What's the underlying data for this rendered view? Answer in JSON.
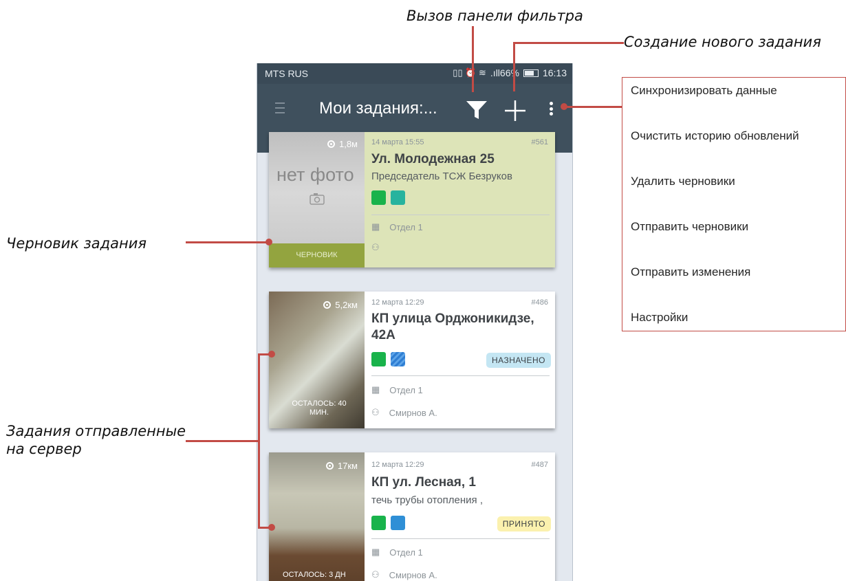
{
  "annotations": {
    "filter_call": "Вызов панели фильтра",
    "new_task": "Создание нового задания",
    "draft_task": "Черновик задания",
    "sent_line1": "Задания отправленные",
    "sent_line2": "на сервер"
  },
  "statusbar": {
    "carrier": "MTS RUS",
    "signal_battery": ".ıll66%",
    "time": "16:13"
  },
  "toolbar": {
    "title": "Мои задания:...",
    "filter_icon": "funnel-icon",
    "add_icon": "plus-icon",
    "more_icon": "more-vert-icon"
  },
  "cards": [
    {
      "date": "14 марта 15:55",
      "number": "#561",
      "title": "Ул. Молодежная 25",
      "subtitle": "Председатель ТСЖ Безруков",
      "distance": "1,8м",
      "photo_placeholder": "нет фото",
      "photo_label": "ЧЕРНОВИК",
      "department": "Отдел 1",
      "person": "",
      "status": ""
    },
    {
      "date": "12 марта 12:29",
      "number": "#486",
      "title": "КП улица Орджоникидзе, 42А",
      "subtitle": "",
      "distance": "5,2км",
      "photo_label": "ОСТАЛОСЬ: 40 МИН.",
      "department": "Отдел 1",
      "person": "Смирнов А.",
      "status": "НАЗНАЧЕНО"
    },
    {
      "date": "12 марта 12:29",
      "number": "#487",
      "title": "КП ул. Лесная, 1",
      "subtitle": "течь трубы отопления ,",
      "distance": "17км",
      "photo_label": "ОСТАЛОСЬ: 3 ДН",
      "department": "Отдел 1",
      "person": "Смирнов А.",
      "status": "ПРИНЯТО"
    }
  ],
  "menu": {
    "items": [
      "Синхронизировать данные",
      "Очистить историю обновлений",
      "Удалить черновики",
      "Отправить черновики",
      "Отправить изменения",
      "Настройки"
    ]
  },
  "colors": {
    "toolbar": "#3f505d",
    "statusbar": "#3a4a57",
    "draft_card": "#dde4b8",
    "draft_label": "#93a43f",
    "annotation": "#c24b45",
    "badge_assigned": "#c4e6f3",
    "badge_accepted": "#fbf1ae",
    "icon_green": "#19b34b",
    "icon_teal": "#27b39e",
    "icon_blue": "#2f8fd6"
  }
}
